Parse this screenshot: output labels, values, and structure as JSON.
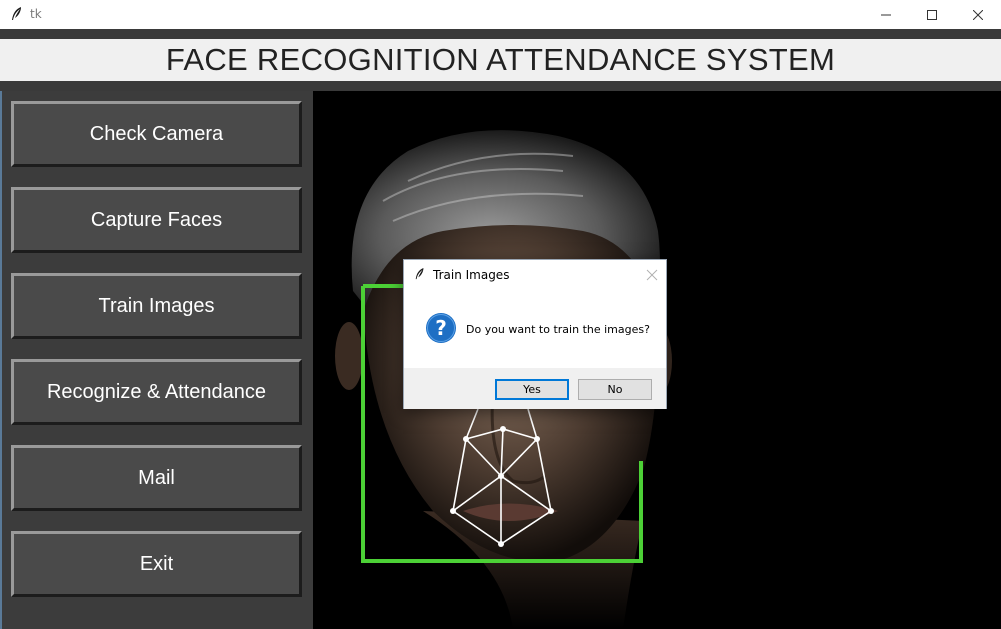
{
  "window": {
    "title": "tk"
  },
  "header": {
    "title": "FACE RECOGNITION ATTENDANCE SYSTEM"
  },
  "sidebar": {
    "buttons": [
      {
        "label": "Check Camera"
      },
      {
        "label": "Capture Faces"
      },
      {
        "label": "Train Images"
      },
      {
        "label": "Recognize & Attendance"
      },
      {
        "label": "Mail"
      },
      {
        "label": "Exit"
      }
    ]
  },
  "dialog": {
    "title": "Train Images",
    "message": "Do you want to train the images?",
    "yes_label": "Yes",
    "no_label": "No",
    "icon": "question-icon"
  },
  "colors": {
    "sidebar_bg": "#3c3c3c",
    "button_bg": "#4a4a4a",
    "header_bg": "#f0f0f0",
    "face_frame": "#4cd136",
    "dialog_accent": "#0078d7"
  }
}
